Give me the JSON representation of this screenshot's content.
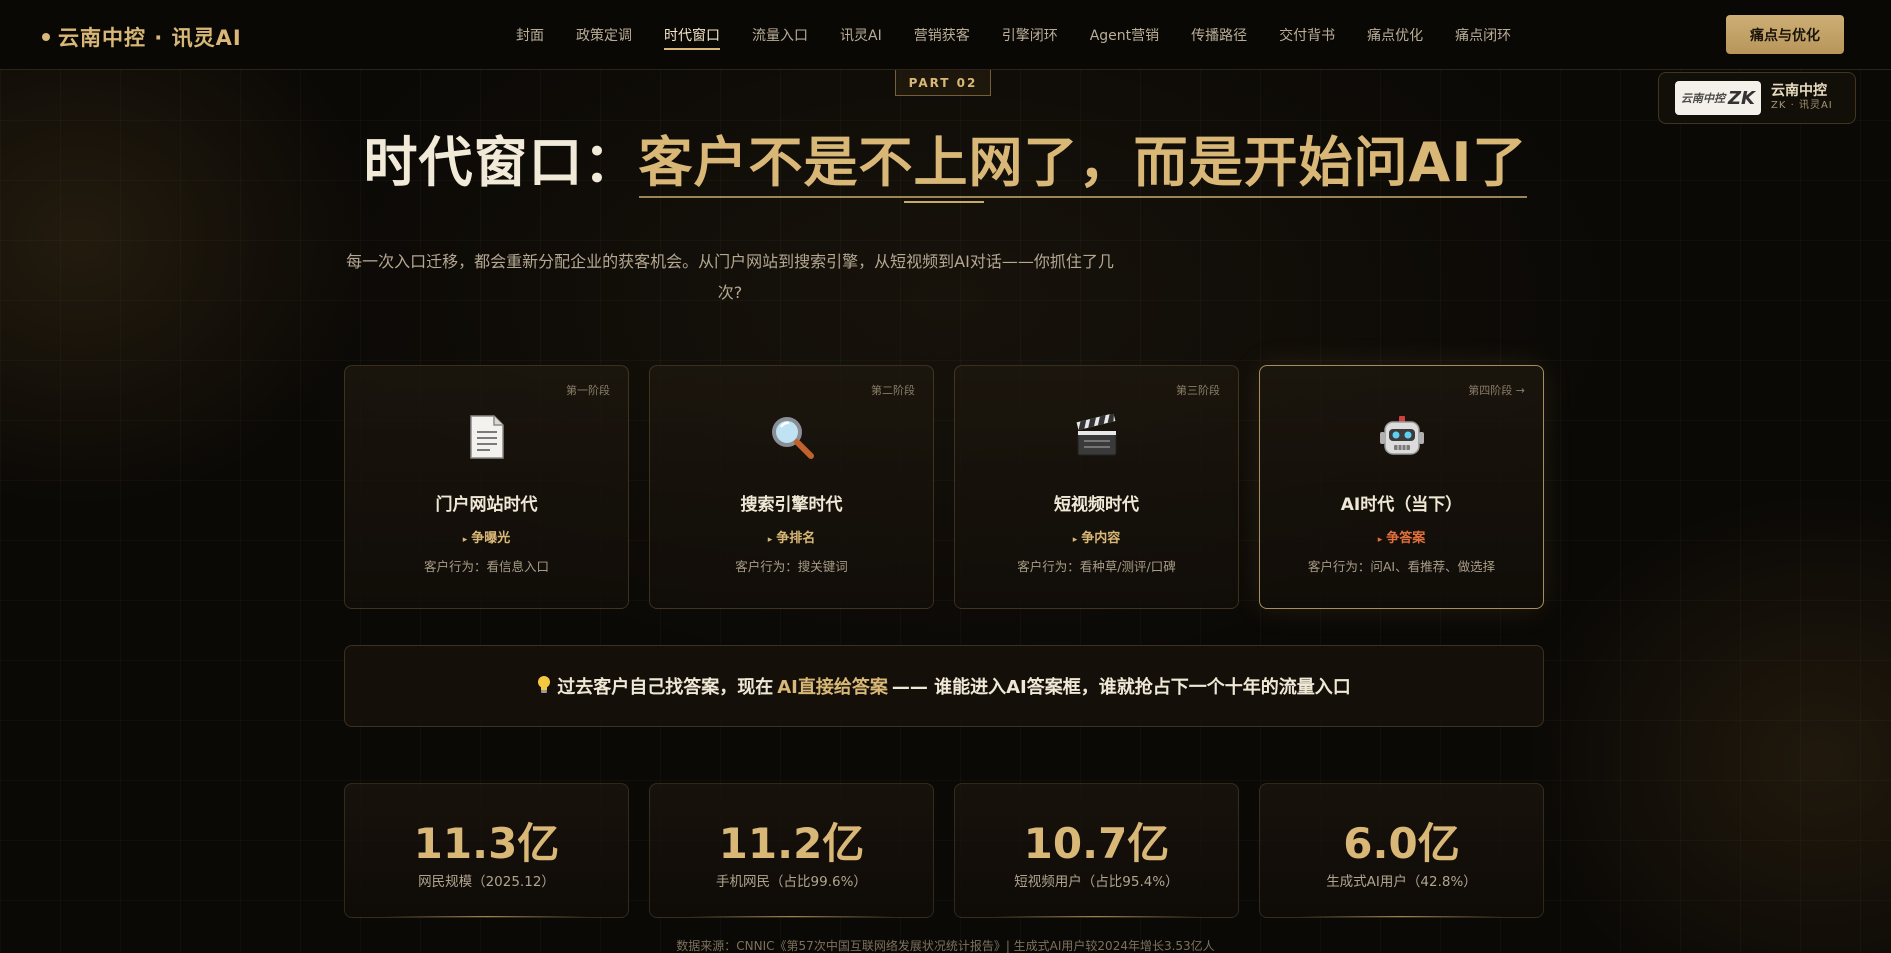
{
  "nav": {
    "brand": "云南中控 · 讯灵AI",
    "links": [
      "封面",
      "政策定调",
      "时代窗口",
      "流量入口",
      "讯灵AI",
      "营销获客",
      "引擎闭环",
      "Agent营销",
      "传播路径",
      "交付背书",
      "痛点优化",
      "痛点闭环"
    ],
    "active_index": 2,
    "cta": "痛点与优化"
  },
  "logo_badge": {
    "mark_text": "云南中控",
    "mark_letters": "ZK",
    "name": "云南中控",
    "sub": "ZK · 讯灵AI"
  },
  "hero": {
    "part": "PART 02",
    "title_prefix": "时代窗口：",
    "title_highlight": "客户不是不上网了，而是开始问AI了",
    "subtitle": "每一次入口迁移，都会重新分配企业的获客机会。从门户网站到搜索引擎，从短视频到AI对话——你抓住了几次?"
  },
  "stages": [
    {
      "phase": "第一阶段",
      "icon": "document-icon",
      "name": "门户网站时代",
      "goal": "争曝光",
      "behavior": "客户行为：看信息入口"
    },
    {
      "phase": "第二阶段",
      "icon": "magnifier-icon",
      "name": "搜索引擎时代",
      "goal": "争排名",
      "behavior": "客户行为：搜关键词"
    },
    {
      "phase": "第三阶段",
      "icon": "clapperboard-icon",
      "name": "短视频时代",
      "goal": "争内容",
      "behavior": "客户行为：看种草/测评/口碑"
    },
    {
      "phase": "第四阶段 →",
      "icon": "robot-icon",
      "name": "AI时代（当下）",
      "goal": "争答案",
      "behavior": "客户行为：问AI、看推荐、做选择"
    }
  ],
  "insight": {
    "before": "过去客户自己找答案，现在",
    "highlight": "AI直接给答案",
    "after": "—— 谁能进入AI答案框，谁就抢占下一个十年的流量入口"
  },
  "stats": [
    {
      "value": "11.3亿",
      "label": "网民规模（2025.12）"
    },
    {
      "value": "11.2亿",
      "label": "手机网民（占比99.6%）"
    },
    {
      "value": "10.7亿",
      "label": "短视频用户（占比95.4%）"
    },
    {
      "value": "6.0亿",
      "label": "生成式AI用户（42.8%）"
    }
  ],
  "source": "数据来源：CNNIC《第57次中国互联网络发展状况统计报告》| 生成式AI用户较2024年增长3.53亿人",
  "colors": {
    "accent": "#d9b877",
    "current_goal": "#e0703c",
    "background": "#0b0906"
  }
}
